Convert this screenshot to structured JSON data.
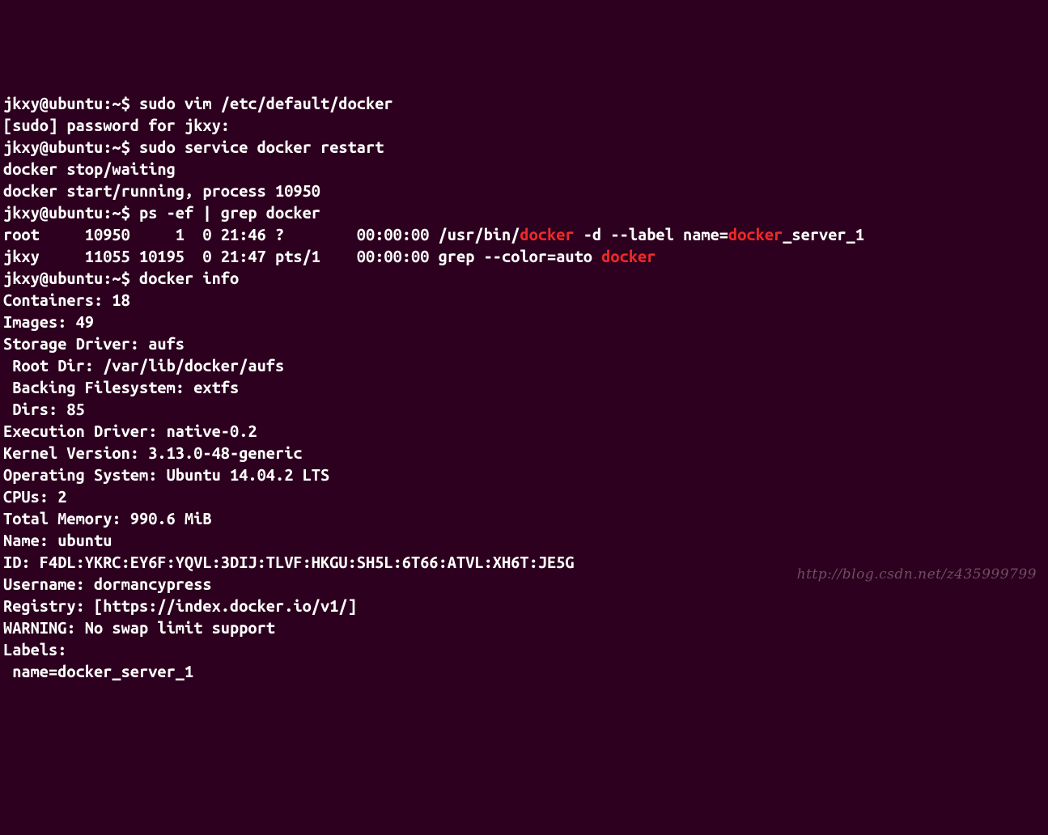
{
  "prompt": "jkxy@ubuntu:~$ ",
  "cmd1": "sudo vim /etc/default/docker",
  "sudo_prompt": "[sudo] password for jkxy:",
  "cmd2": "sudo service docker restart",
  "svc_out1": "docker stop/waiting",
  "svc_out2": "docker start/running, process 10950",
  "cmd3": "ps -ef | grep docker",
  "ps1_a": "root     10950     1  0 21:46 ?        00:00:00 /usr/bin/",
  "ps1_hl1": "docker",
  "ps1_b": " -d --label name=",
  "ps1_hl2": "docker",
  "ps1_c": "_server_1",
  "ps2_a": "jkxy     11055 10195  0 21:47 pts/1    00:00:00 grep --color=auto ",
  "ps2_hl": "docker",
  "cmd4": "docker info",
  "info": {
    "containers": "Containers: 18",
    "images": "Images: 49",
    "storage_driver": "Storage Driver: aufs",
    "root_dir": " Root Dir: /var/lib/docker/aufs",
    "backing_fs": " Backing Filesystem: extfs",
    "dirs": " Dirs: 85",
    "exec_driver": "Execution Driver: native-0.2",
    "kernel": "Kernel Version: 3.13.0-48-generic",
    "os": "Operating System: Ubuntu 14.04.2 LTS",
    "cpus": "CPUs: 2",
    "memory": "Total Memory: 990.6 MiB",
    "name": "Name: ubuntu",
    "id": "ID: F4DL:YKRC:EY6F:YQVL:3DIJ:TLVF:HKGU:SH5L:6T66:ATVL:XH6T:JE5G",
    "username": "Username: dormancypress",
    "registry": "Registry: [https://index.docker.io/v1/]",
    "warning": "WARNING: No swap limit support",
    "labels": "Labels:",
    "label_item": " name=docker_server_1"
  },
  "watermark": "http://blog.csdn.net/z435999799"
}
